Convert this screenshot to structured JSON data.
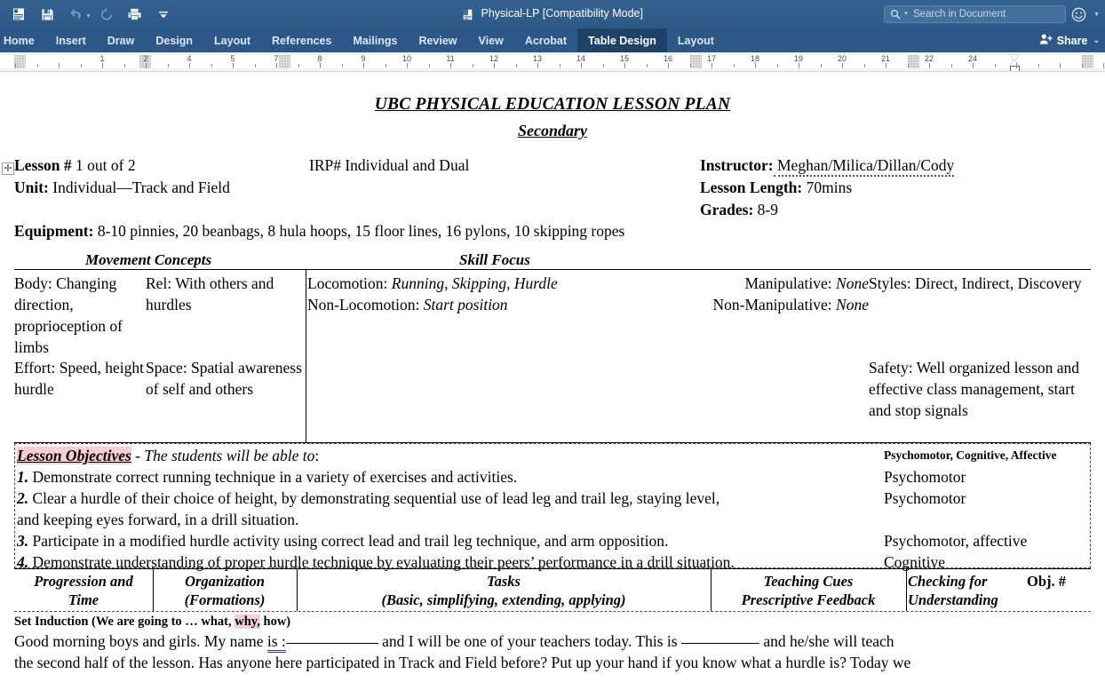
{
  "window": {
    "title": "Physical-LP [Compatibility Mode]",
    "title_icon": "word-document-icon"
  },
  "quick_access": [
    {
      "name": "new-document-icon",
      "label": "New"
    },
    {
      "name": "save-icon",
      "label": "Save"
    },
    {
      "name": "undo-icon",
      "label": "Undo"
    },
    {
      "name": "redo-icon",
      "label": "Redo"
    },
    {
      "name": "print-icon",
      "label": "Print"
    },
    {
      "name": "customize-toolbar-icon",
      "label": "Customize"
    }
  ],
  "search": {
    "placeholder": "Search in Document",
    "value": ""
  },
  "account": {
    "icon": "smiley-face-icon"
  },
  "ribbon": {
    "tabs": [
      {
        "label": "Home",
        "active": false
      },
      {
        "label": "Insert",
        "active": false
      },
      {
        "label": "Draw",
        "active": false
      },
      {
        "label": "Design",
        "active": false
      },
      {
        "label": "Layout",
        "active": false
      },
      {
        "label": "References",
        "active": false
      },
      {
        "label": "Mailings",
        "active": false
      },
      {
        "label": "Review",
        "active": false
      },
      {
        "label": "View",
        "active": false
      },
      {
        "label": "Acrobat",
        "active": false
      },
      {
        "label": "Table Design",
        "active": true
      },
      {
        "label": "Layout",
        "active": false
      }
    ],
    "share_label": "Share",
    "accent_blue": "#2d5689",
    "active_tab_blue": "#1e4268",
    "titlebar_blue": "#33608f"
  },
  "ruler": {
    "unit_numbers": [
      1,
      2,
      4,
      5,
      7,
      8,
      9,
      10,
      11,
      12,
      13,
      14,
      15,
      16,
      17,
      18,
      19,
      20,
      21,
      22,
      24
    ]
  },
  "document": {
    "title": "UBC PHYSICAL EDUCATION LESSON PLAN",
    "subtitle": "Secondary",
    "meta": {
      "lesson_label": "Lesson #",
      "lesson_value": " 1 out of 2",
      "unit_label": "Unit:",
      "unit_value": " Individual—Track and Field",
      "irp_label": "IRP#",
      "irp_value": " Individual and Dual",
      "instructor_label": "Instructor:",
      "instructor_value": " Meghan/Milica/Dillan/Cody",
      "length_label": "Lesson Length:",
      "length_value": " 70mins",
      "grades_label": "Grades:",
      "grades_value": " 8-9"
    },
    "equipment": {
      "label": "Equipment:",
      "value": " 8-10 pinnies, 20 beanbags, 8 hula hoops, 15 floor lines, 16 pylons, 10 skipping ropes"
    },
    "concepts_table": {
      "header_movement": "Movement Concepts",
      "header_skill": "Skill Focus",
      "body": "Body: Changing direction, proprioception of limbs",
      "rel": "Rel: With others and hurdles",
      "locomotion_label": "Locomotion:",
      "locomotion_value": " Running, Skipping, Hurdle",
      "nonlocomotion_label": "Non-Locomotion:",
      "nonlocomotion_value": " Start position",
      "manipulative_label": "Manipulative:",
      "manipulative_value": " None",
      "nonmanipulative_label": "Non-Manipulative:",
      "nonmanipulative_value": " None",
      "styles": "Styles: Direct, Indirect, Discovery",
      "effort": "Effort: Speed, height hurdle",
      "space": "Space: Spatial awareness of self and others",
      "safety": "Safety: Well organized lesson and effective class management, start and stop signals"
    },
    "objectives": {
      "heading_highlight": "Lesson Objectives",
      "heading_rest": " - The students will be able to",
      "heading_colon": ":",
      "heading_tag": "Psychomotor, Cognitive, Affective",
      "items": [
        {
          "num": "1.",
          "text": " Demonstrate correct running technique in a variety of exercises and activities.",
          "tag": "Psychomotor"
        },
        {
          "num": "2.",
          "text": " Clear a hurdle of their choice of height, by demonstrating sequential use of lead leg and trail leg, staying level,",
          "text2": "and keeping eyes forward, in a drill situation.",
          "tag": "Psychomotor"
        },
        {
          "num": "3.",
          "text": " Participate in a modified hurdle activity using correct lead and trail leg technique, and arm opposition.",
          "tag": "Psychomotor, affective"
        },
        {
          "num": "4.",
          "text": " Demonstrate understanding of proper hurdle technique by evaluating their peers’ performance in a drill situation.",
          "tag": "Cognitive"
        }
      ]
    },
    "progression_table": {
      "col1_l1": "Progression and",
      "col1_l2": "Time",
      "col2_l1": "Organization",
      "col2_l2": "(Formations)",
      "col3_l1": "Tasks",
      "col3_l2": "(Basic, simplifying, extending, applying)",
      "col4_l1": "Teaching Cues",
      "col4_l2": "Prescriptive Feedback",
      "col5_l1": "Checking for",
      "col5_l2": "Understanding",
      "col6": "Obj. #"
    },
    "set_induction": {
      "heading_a": "Set Induction (We are going to … what, ",
      "heading_hl": "why,",
      "heading_b": " how)",
      "line1_a": "Good morning boys and girls. My name ",
      "line1_is": "is :",
      "line1_b": " and I will be one of your teachers today. This is ",
      "line1_c": " and he/she will teach",
      "line2": "the second half of the lesson. Has anyone here participated in Track and Field before? Put up your hand if you know what a hurdle is? Today we"
    }
  }
}
